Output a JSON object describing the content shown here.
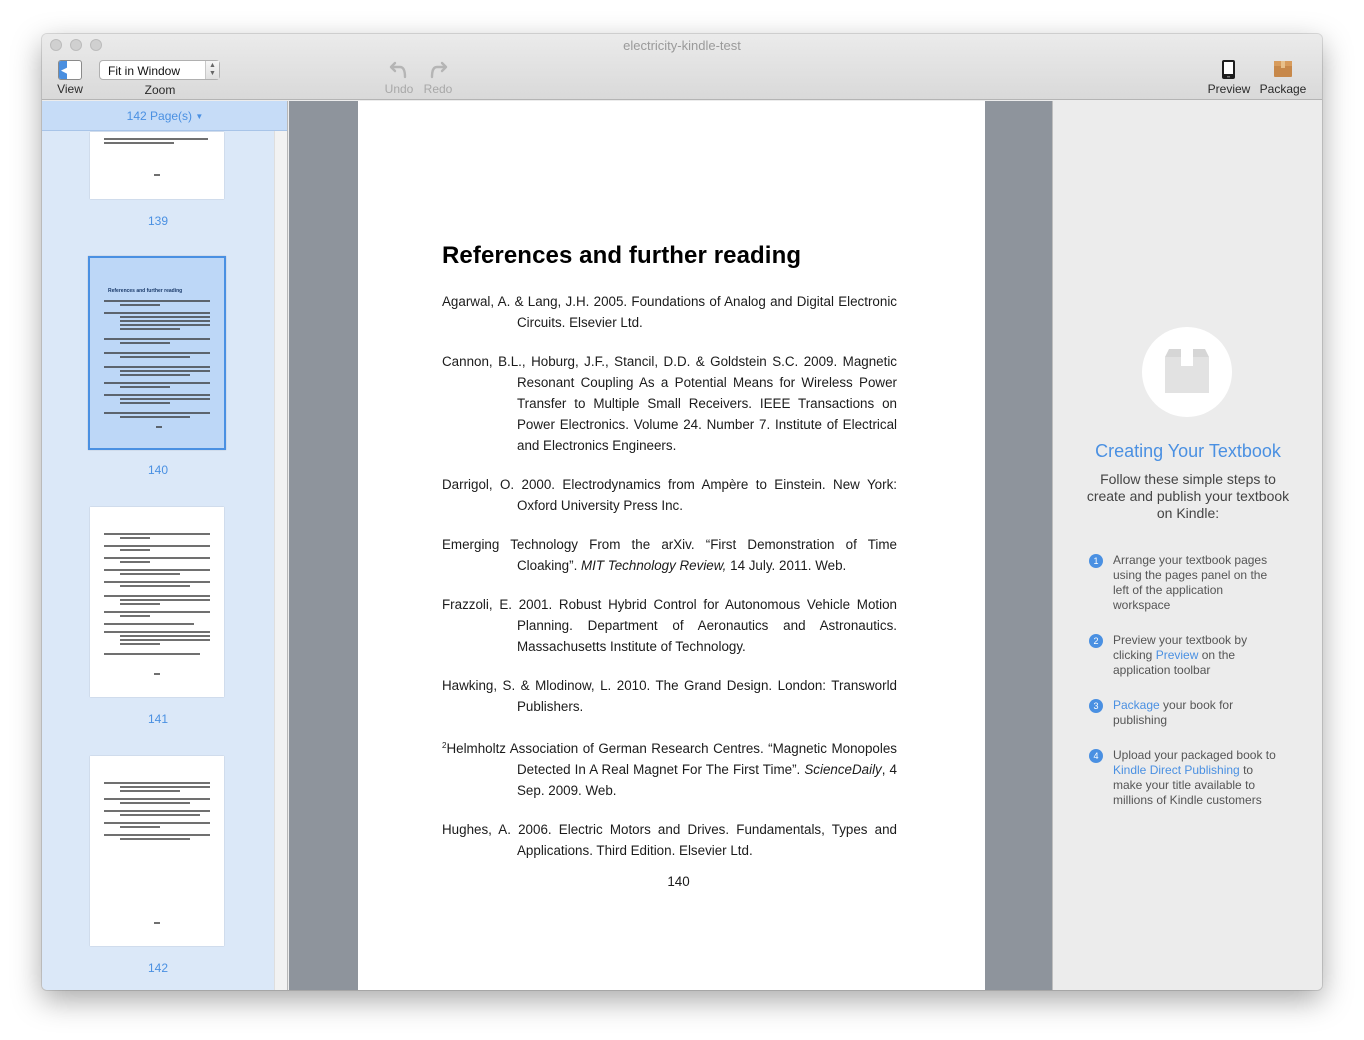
{
  "window": {
    "title": "electricity-kindle-test"
  },
  "toolbar": {
    "view_label": "View",
    "zoom_label": "Zoom",
    "zoom_value": "Fit in Window",
    "undo_label": "Undo",
    "redo_label": "Redo",
    "preview_label": "Preview",
    "package_label": "Package"
  },
  "sidebar": {
    "page_count": "142 Page(s)",
    "selected_page": "140",
    "thumbnails": [
      {
        "label": "139"
      },
      {
        "label": "140",
        "title": "References and further reading"
      },
      {
        "label": "141"
      },
      {
        "label": "142"
      }
    ]
  },
  "document": {
    "heading": "References and further reading",
    "page_number": "140",
    "references": [
      {
        "text": "Agarwal, A. & Lang, J.H. 2005. Foundations of Analog and Digital Electronic Circuits. Elsevier Ltd."
      },
      {
        "text": "Cannon, B.L., Hoburg, J.F., Stancil, D.D. & Goldstein S.C. 2009. Magnetic Resonant Coupling As a Potential Means for Wireless Power Transfer to Multiple Small Receivers. IEEE Transactions on Power Electronics. Volume 24. Number 7. Institute of Electrical and Electronics Engineers."
      },
      {
        "text": "Darrigol, O. 2000. Electrodynamics from Ampère to Einstein. New York: Oxford University Press Inc."
      },
      {
        "pre": "Emerging Technology From the arXiv. “First Demonstration of Time Cloaking”. ",
        "italic": "MIT Technology Review,",
        "post": " 14 July. 2011. Web."
      },
      {
        "text": "Frazzoli, E. 2001. Robust Hybrid Control for Autonomous Vehicle Motion Planning. Department of Aeronautics and Astronautics. Massachusetts Institute of Technology."
      },
      {
        "text": "Hawking, S. & Mlodinow, L. 2010. The Grand Design. London: Transworld Publishers."
      },
      {
        "sup": "2",
        "pre": "Helmholtz Association of German Research Centres. “Magnetic Monopoles Detected In A Real Magnet For The First Time”. ",
        "italic": "ScienceDaily",
        "post": ", 4 Sep. 2009. Web."
      },
      {
        "text": "Hughes, A. 2006. Electric Motors and Drives. Fundamentals, Types and Applications. Third Edition. Elsevier Ltd."
      }
    ]
  },
  "help_panel": {
    "title": "Creating Your Textbook",
    "subtitle": "Follow these simple steps to create and publish your textbook on Kindle:",
    "steps": [
      {
        "num": "1",
        "pre": "Arrange your textbook pages using the pages panel on the left of the application workspace",
        "link": "",
        "post": ""
      },
      {
        "num": "2",
        "pre": "Preview your textbook by clicking ",
        "link": "Preview",
        "post": " on the application toolbar"
      },
      {
        "num": "3",
        "pre": "",
        "link": "Package",
        "post": " your book for publishing"
      },
      {
        "num": "4",
        "pre": "Upload your packaged book to ",
        "link": "Kindle Direct Publishing",
        "post": " to make your title available to millions of Kindle customers"
      }
    ]
  },
  "colors": {
    "accent": "#4a90e2",
    "sidebar_bg": "#dbe8f8",
    "workspace_bg": "#8e949c"
  }
}
